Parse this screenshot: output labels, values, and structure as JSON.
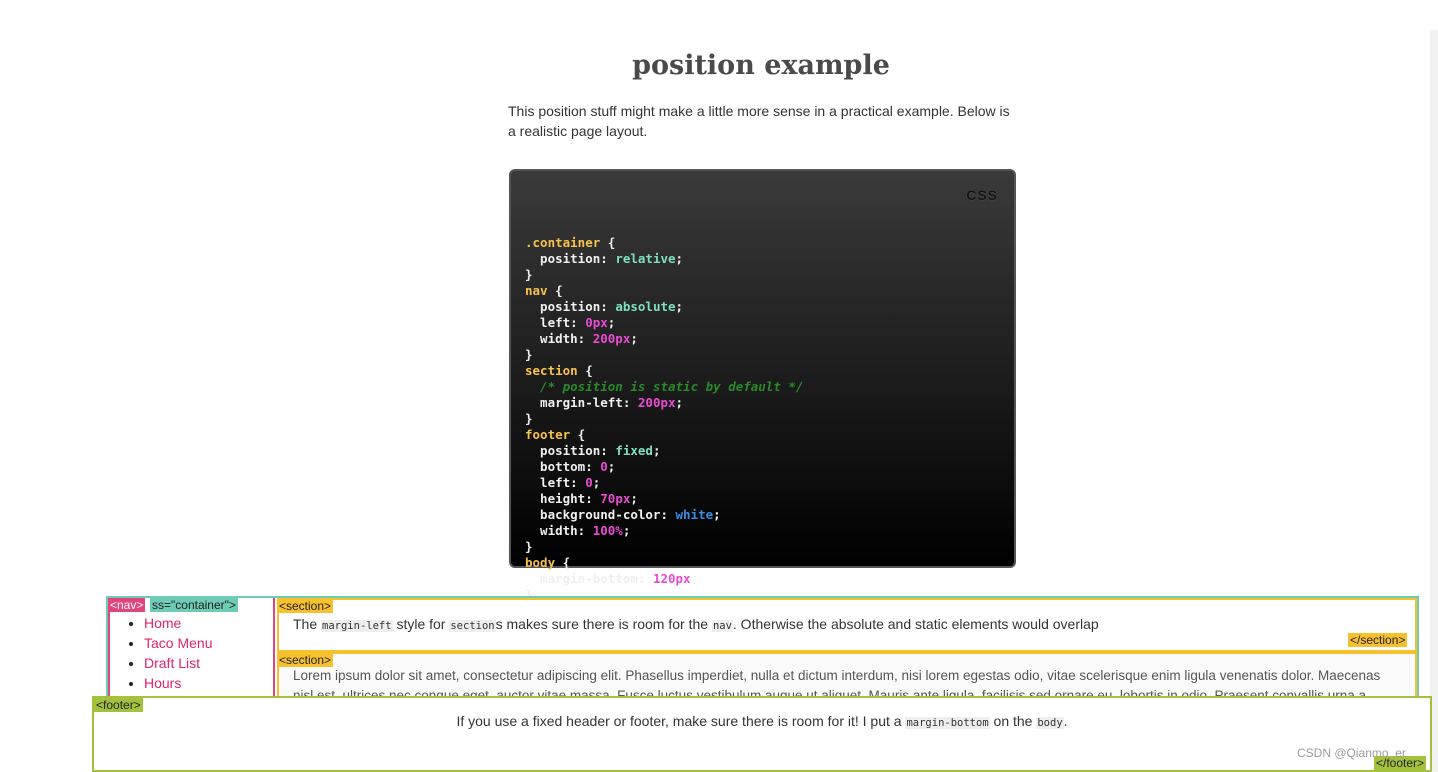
{
  "page": {
    "title": "position example",
    "intro": "This position stuff might make a little more sense in a practical example. Below is a realistic page layout."
  },
  "code": {
    "lang_label": "CSS",
    "lines": [
      [
        {
          "t": ".container",
          "c": "sel"
        },
        {
          "t": " {",
          "c": "prop"
        }
      ],
      [
        {
          "t": "  position: ",
          "c": "prop"
        },
        {
          "t": "relative",
          "c": "kw"
        },
        {
          "t": ";",
          "c": "prop"
        }
      ],
      [
        {
          "t": "}",
          "c": "prop"
        }
      ],
      [
        {
          "t": "nav",
          "c": "sel"
        },
        {
          "t": " {",
          "c": "prop"
        }
      ],
      [
        {
          "t": "  position: ",
          "c": "prop"
        },
        {
          "t": "absolute",
          "c": "kw"
        },
        {
          "t": ";",
          "c": "prop"
        }
      ],
      [
        {
          "t": "  left: ",
          "c": "prop"
        },
        {
          "t": "0px",
          "c": "num"
        },
        {
          "t": ";",
          "c": "prop"
        }
      ],
      [
        {
          "t": "  width: ",
          "c": "prop"
        },
        {
          "t": "200px",
          "c": "num"
        },
        {
          "t": ";",
          "c": "prop"
        }
      ],
      [
        {
          "t": "}",
          "c": "prop"
        }
      ],
      [
        {
          "t": "section",
          "c": "sel"
        },
        {
          "t": " {",
          "c": "prop"
        }
      ],
      [
        {
          "t": "  /* position is static by default */",
          "c": "com"
        }
      ],
      [
        {
          "t": "  margin-left: ",
          "c": "prop"
        },
        {
          "t": "200px",
          "c": "num"
        },
        {
          "t": ";",
          "c": "prop"
        }
      ],
      [
        {
          "t": "}",
          "c": "prop"
        }
      ],
      [
        {
          "t": "footer",
          "c": "sel"
        },
        {
          "t": " {",
          "c": "prop"
        }
      ],
      [
        {
          "t": "  position: ",
          "c": "prop"
        },
        {
          "t": "fixed",
          "c": "kw"
        },
        {
          "t": ";",
          "c": "prop"
        }
      ],
      [
        {
          "t": "  bottom: ",
          "c": "prop"
        },
        {
          "t": "0",
          "c": "num"
        },
        {
          "t": ";",
          "c": "prop"
        }
      ],
      [
        {
          "t": "  left: ",
          "c": "prop"
        },
        {
          "t": "0",
          "c": "num"
        },
        {
          "t": ";",
          "c": "prop"
        }
      ],
      [
        {
          "t": "  height: ",
          "c": "prop"
        },
        {
          "t": "70px",
          "c": "num"
        },
        {
          "t": ";",
          "c": "prop"
        }
      ],
      [
        {
          "t": "  background-color: ",
          "c": "prop"
        },
        {
          "t": "white",
          "c": "col"
        },
        {
          "t": ";",
          "c": "prop"
        }
      ],
      [
        {
          "t": "  width: ",
          "c": "prop"
        },
        {
          "t": "100%",
          "c": "num"
        },
        {
          "t": ";",
          "c": "prop"
        }
      ],
      [
        {
          "t": "}",
          "c": "prop"
        }
      ],
      [
        {
          "t": "body",
          "c": "sel"
        },
        {
          "t": " {",
          "c": "prop"
        }
      ],
      [
        {
          "t": "  margin-bottom: ",
          "c": "prop"
        },
        {
          "t": "120px",
          "c": "num"
        },
        {
          "t": ";",
          "c": "prop"
        }
      ],
      [
        {
          "t": "}",
          "c": "prop"
        }
      ]
    ]
  },
  "demo": {
    "container_tag": "ss=\"container\">",
    "nav_tag": "<nav>",
    "nav_items": [
      "Home",
      "Taco Menu",
      "Draft List",
      "Hours"
    ],
    "section_tag": "<section>",
    "section_close_tag": "</section>",
    "section1": {
      "pre": "The ",
      "code1": "margin-left",
      "mid1": " style for ",
      "code2": "section",
      "mid2": "s makes sure there is room for the ",
      "code3": "nav",
      "post": ". Otherwise the absolute and static elements would overlap"
    },
    "section2_text": "Lorem ipsum dolor sit amet, consectetur adipiscing elit. Phasellus imperdiet, nulla et dictum interdum, nisi lorem egestas odio, vitae scelerisque enim ligula venenatis dolor. Maecenas nisl est, ultrices nec congue eget, auctor vitae massa. Fusce luctus vestibulum augue ut aliquet. Mauris ante ligula, facilisis sed ornare eu, lobortis in odio. Praesent convallis urna a",
    "footer_tag": "<footer>",
    "footer_close_tag": "</footer>",
    "footer": {
      "pre": "If you use a fixed header or footer, make sure there is room for it! I put a ",
      "code1": "margin-bottom",
      "mid": " on the ",
      "code2": "body",
      "post": "."
    }
  },
  "watermark": "CSDN @Qianmo_er",
  "colors": {
    "container_border": "#6ecbb6",
    "nav_border": "#e0457b",
    "section_border": "#f7c12e",
    "footer_border": "#a4c13b",
    "nav_link": "#e02469"
  }
}
